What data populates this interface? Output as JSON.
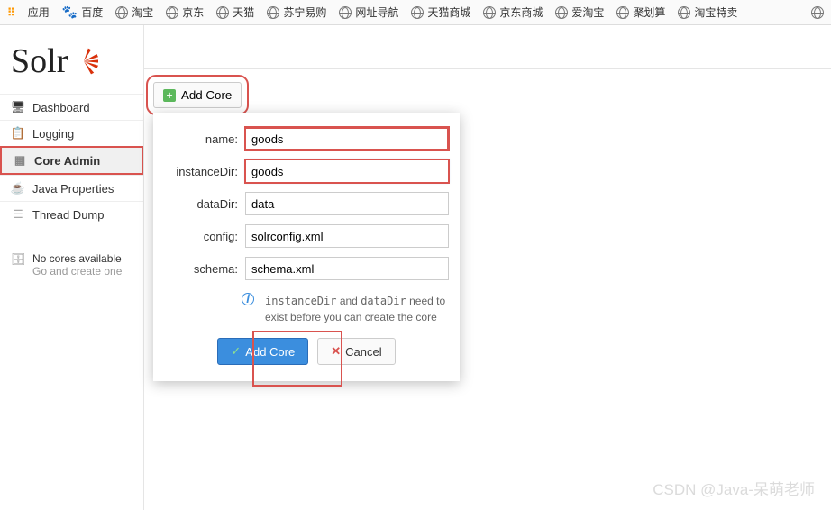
{
  "bookmarks": {
    "apps_label": "应用",
    "items": [
      {
        "label": "百度",
        "icon": "paw"
      },
      {
        "label": "淘宝",
        "icon": "globe"
      },
      {
        "label": "京东",
        "icon": "globe"
      },
      {
        "label": "天猫",
        "icon": "globe"
      },
      {
        "label": "苏宁易购",
        "icon": "globe"
      },
      {
        "label": "网址导航",
        "icon": "globe"
      },
      {
        "label": "天猫商城",
        "icon": "globe"
      },
      {
        "label": "京东商城",
        "icon": "globe"
      },
      {
        "label": "爱淘宝",
        "icon": "globe"
      },
      {
        "label": "聚划算",
        "icon": "globe"
      },
      {
        "label": "淘宝特卖",
        "icon": "globe"
      }
    ]
  },
  "logo": {
    "text": "Solr"
  },
  "sidebar": {
    "items": [
      {
        "label": "Dashboard",
        "icon": "dashboard"
      },
      {
        "label": "Logging",
        "icon": "logging"
      },
      {
        "label": "Core Admin",
        "icon": "core-admin",
        "active": true
      },
      {
        "label": "Java Properties",
        "icon": "java"
      },
      {
        "label": "Thread Dump",
        "icon": "thread"
      }
    ],
    "no_cores_title": "No cores available",
    "no_cores_sub": "Go and create one"
  },
  "toolbar": {
    "add_core_label": "Add Core"
  },
  "dialog": {
    "fields": {
      "name": {
        "label": "name:",
        "value": "goods"
      },
      "instanceDir": {
        "label": "instanceDir:",
        "value": "goods"
      },
      "dataDir": {
        "label": "dataDir:",
        "value": "data"
      },
      "config": {
        "label": "config:",
        "value": "solrconfig.xml"
      },
      "schema": {
        "label": "schema:",
        "value": "schema.xml"
      }
    },
    "info_prefix": "instanceDir",
    "info_mid": " and ",
    "info_code2": "dataDir",
    "info_suffix": " need to exist before you can create the core",
    "submit_label": "Add Core",
    "cancel_label": "Cancel"
  },
  "watermark": "CSDN @Java-呆萌老师"
}
